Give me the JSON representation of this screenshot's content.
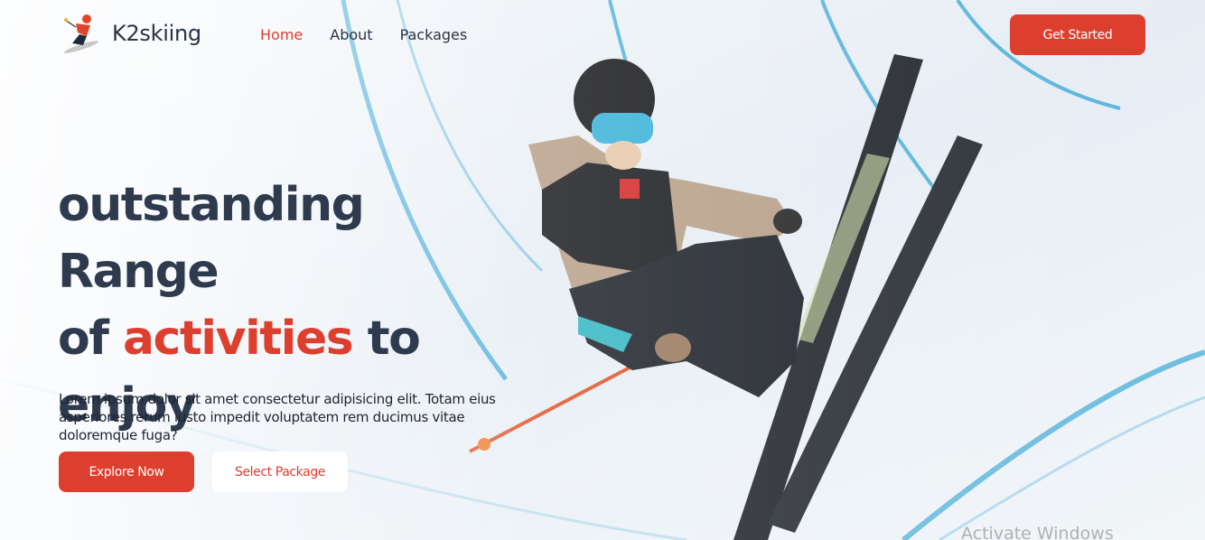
{
  "brand": {
    "name": "K2skiing",
    "logo_icon": "skier-logo-icon"
  },
  "nav": {
    "links": [
      {
        "label": "Home",
        "active": true
      },
      {
        "label": "About",
        "active": false
      },
      {
        "label": "Packages",
        "active": false
      }
    ],
    "cta_label": "Get Started"
  },
  "hero": {
    "headline_part1": "outstanding Range",
    "headline_part2": "of",
    "headline_accent": "activities",
    "headline_part3": "to",
    "headline_part4": "enjoy",
    "description": "Lorem ipsum dolor sit amet consectetur adipisicing elit. Totam eius asperiores rerum iusto impedit voluptatem rem ducimus vitae doloremque fuga?",
    "primary_button": "Explore Now",
    "secondary_button": "Select Package",
    "background_image": "halfpipe-freestyle-skier-image"
  },
  "os_watermark": "Activate Windows",
  "colors": {
    "accent": "#dd3f2f",
    "heading": "#2e3a4d",
    "text": "#1f2430"
  }
}
